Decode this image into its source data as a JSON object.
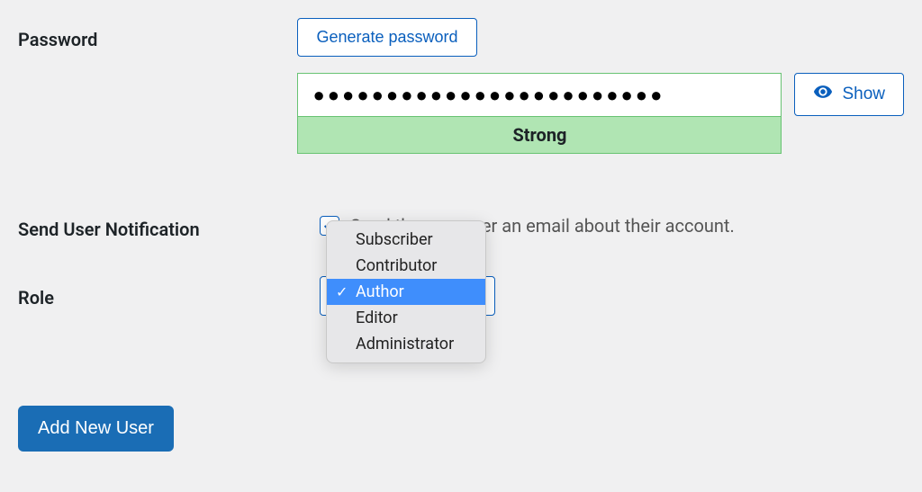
{
  "password": {
    "label": "Password",
    "generate_button": "Generate password",
    "masked_value": "●●●●●●●●●●●●●●●●●●●●●●●●",
    "strength_label": "Strong",
    "show_button": "Show"
  },
  "notification": {
    "label": "Send User Notification",
    "checkbox_checked": true,
    "checkbox_text": "Send the new user an email about their account."
  },
  "role": {
    "label": "Role",
    "selected": "Author",
    "options": [
      "Subscriber",
      "Contributor",
      "Author",
      "Editor",
      "Administrator"
    ]
  },
  "submit": {
    "label": "Add New User"
  }
}
